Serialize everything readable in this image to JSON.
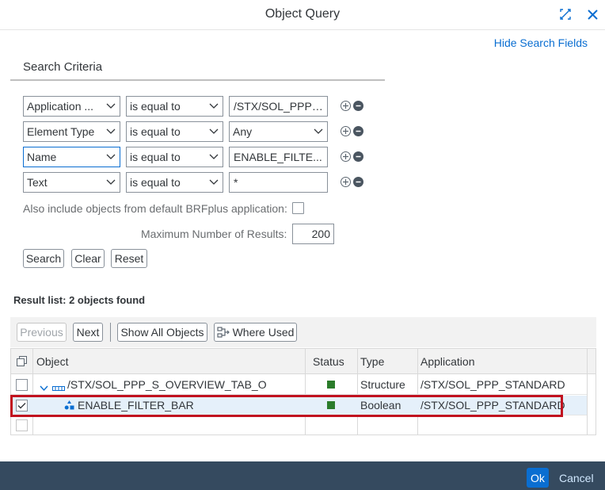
{
  "dialog": {
    "title": "Object Query",
    "hide_search_fields": "Hide Search Fields"
  },
  "search": {
    "section_title": "Search Criteria",
    "rows": [
      {
        "field": "Application ...",
        "operator": "is equal to",
        "value": "/STX/SOL_PPP_...",
        "value_is_select": false
      },
      {
        "field": "Element Type",
        "operator": "is equal to",
        "value": "Any",
        "value_is_select": true
      },
      {
        "field": "Name",
        "operator": "is equal to",
        "value": "ENABLE_FILTE...",
        "value_is_select": false
      },
      {
        "field": "Text",
        "operator": "is equal to",
        "value": "*",
        "value_is_select": false
      }
    ],
    "include_default_label": "Also include objects from default BRFplus application:",
    "include_default_checked": false,
    "max_results_label": "Maximum Number of Results:",
    "max_results_value": "200",
    "buttons": {
      "search": "Search",
      "clear": "Clear",
      "reset": "Reset"
    }
  },
  "results": {
    "title": "Result list: 2  objects found",
    "toolbar": {
      "previous": "Previous",
      "next": "Next",
      "show_all": "Show All Objects",
      "where_used": "Where Used"
    },
    "columns": [
      "Object",
      "Status",
      "Type",
      "Application"
    ],
    "rows": [
      {
        "object": "/STX/SOL_PPP_S_OVERVIEW_TAB_O",
        "status": "active",
        "type": "Structure",
        "application": "/STX/SOL_PPP_STANDARD",
        "checked": false,
        "expanded": true
      },
      {
        "object": "ENABLE_FILTER_BAR",
        "status": "active",
        "type": "Boolean",
        "application": "/STX/SOL_PPP_STANDARD",
        "checked": true,
        "selected": true
      }
    ]
  },
  "footer": {
    "ok": "Ok",
    "cancel": "Cancel"
  },
  "colors": {
    "accent": "#0a6ed1",
    "footer_bg": "#354a5f",
    "status_green": "#2b7c2b",
    "highlight_red": "#c1121f"
  }
}
